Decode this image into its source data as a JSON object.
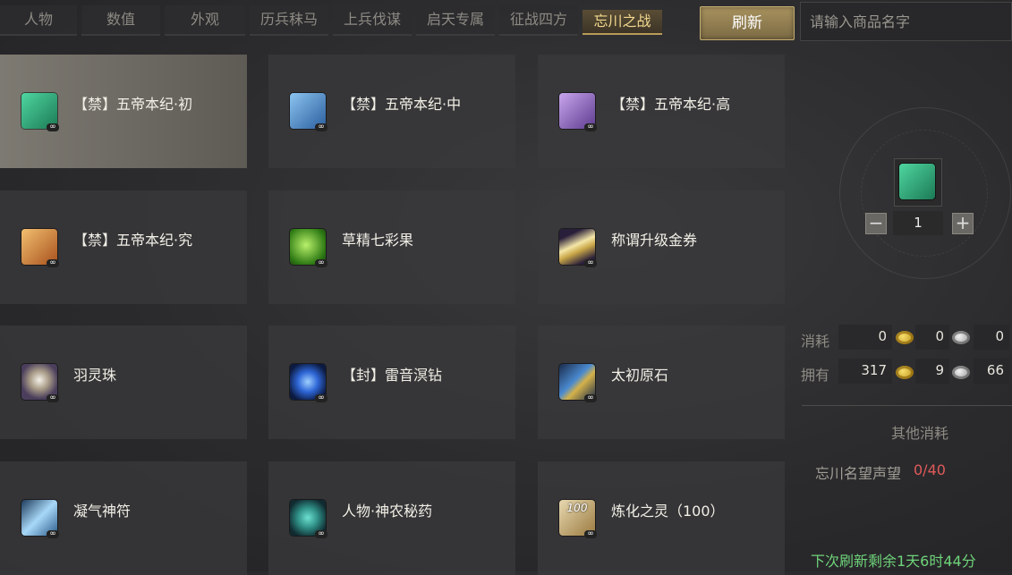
{
  "tabs": [
    {
      "label": "人物"
    },
    {
      "label": "数值"
    },
    {
      "label": "外观"
    },
    {
      "label": "历兵秣马"
    },
    {
      "label": "上兵伐谋"
    },
    {
      "label": "启天专属"
    },
    {
      "label": "征战四方"
    },
    {
      "label": "忘川之战",
      "active": true
    }
  ],
  "toolbar": {
    "refresh_label": "刷新",
    "search_placeholder": "请输入商品名字",
    "search_value": ""
  },
  "items": [
    {
      "name": "【禁】五帝本纪·初",
      "icon": "green-book-icon",
      "badge": "∞",
      "color": "#2aa57a"
    },
    {
      "name": "【禁】五帝本纪·中",
      "icon": "blue-book-icon",
      "badge": "∞",
      "color": "#3b7fc4"
    },
    {
      "name": "【禁】五帝本纪·高",
      "icon": "purple-book-icon",
      "badge": "∞",
      "color": "#8a5cbf"
    },
    {
      "name": "【禁】五帝本纪·究",
      "icon": "orange-book-icon",
      "badge": "∞",
      "color": "#d07a2a"
    },
    {
      "name": "草精七彩果",
      "icon": "green-fruit-icon",
      "badge": "∞",
      "color": "#5fbf2e"
    },
    {
      "name": "称谓升级金券",
      "icon": "gold-ticket-icon",
      "badge": "∞",
      "color": "#d8c27a"
    },
    {
      "name": "羽灵珠",
      "icon": "pearl-icon",
      "badge": "∞",
      "color": "#8a7aa8"
    },
    {
      "name": "【封】雷音溟钻",
      "icon": "blue-gem-icon",
      "badge": "∞",
      "color": "#2e66d6"
    },
    {
      "name": "太初原石",
      "icon": "raw-stone-icon",
      "badge": "∞",
      "color": "#3a6fb0"
    },
    {
      "name": "凝气神符",
      "icon": "talisman-icon",
      "badge": "∞",
      "color": "#5aa0d8"
    },
    {
      "name": "人物·神农秘药",
      "icon": "potion-icon",
      "badge": "∞",
      "color": "#2f8f86"
    },
    {
      "name": "炼化之灵（100）",
      "icon": "spirit-100-icon",
      "badge": "∞",
      "icon_text": "100",
      "color": "#b89a5c"
    }
  ],
  "selected_item": {
    "icon": "green-book-icon",
    "color": "#2aa57a",
    "quantity": "1",
    "minus_label": "−",
    "plus_label": "+"
  },
  "cost": {
    "consume_label": "消耗",
    "own_label": "拥有",
    "consume": [
      "0",
      "0",
      "0"
    ],
    "own": [
      "317",
      "9",
      "66"
    ],
    "currency_icons": [
      "gold-coin-icon",
      "silver-coin-icon"
    ]
  },
  "other_cost": {
    "title": "其他消耗",
    "reputation_label": "忘川名望声望",
    "reputation_value": "0/40"
  },
  "footer": {
    "countdown": "下次刷新剩余1天6时44分"
  }
}
